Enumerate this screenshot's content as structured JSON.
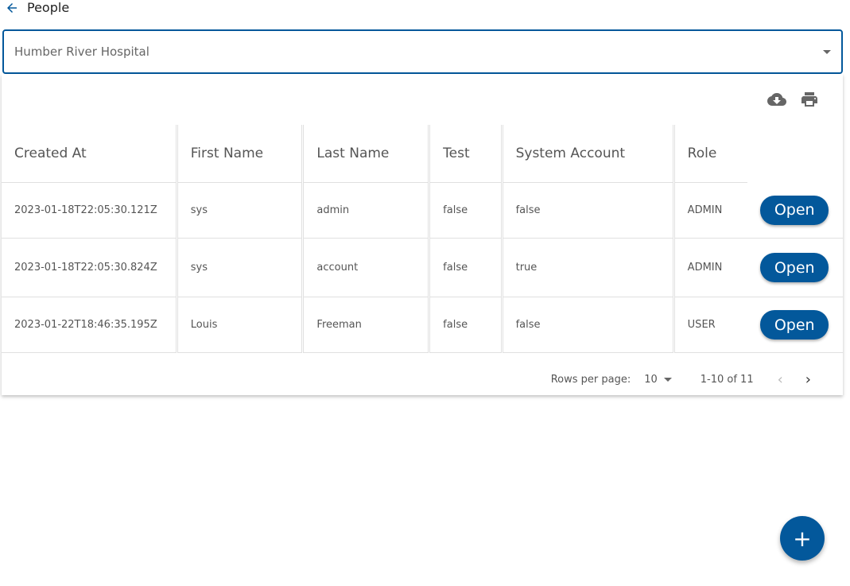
{
  "header": {
    "title": "People"
  },
  "select": {
    "value": "Humber River Hospital"
  },
  "table": {
    "columns": [
      "Created At",
      "First Name",
      "Last Name",
      "Test",
      "System Account",
      "Role"
    ],
    "rows": [
      [
        "2023-01-18T22:05:30.121Z",
        "sys",
        "admin",
        "false",
        "false",
        "ADMIN"
      ],
      [
        "2023-01-18T22:05:30.824Z",
        "sys",
        "account",
        "false",
        "true",
        "ADMIN"
      ],
      [
        "2023-01-22T18:46:35.195Z",
        "Louis",
        "Freeman",
        "false",
        "false",
        "USER"
      ]
    ],
    "action_label": "Open"
  },
  "footer": {
    "rows_per_page_label": "Rows per page:",
    "rows_per_page": "10",
    "range": "1-10 of 11"
  },
  "fab": {
    "label": "+"
  },
  "colors": {
    "accent": "#03589b"
  }
}
